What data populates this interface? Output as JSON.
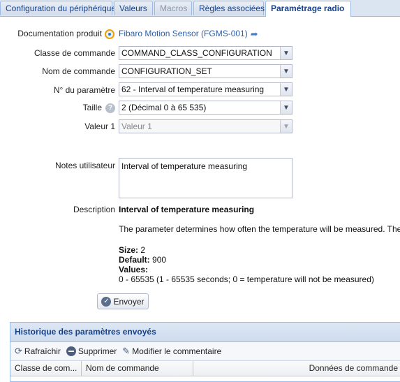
{
  "tabs": [
    {
      "label": "Configuration du périphérique",
      "state": "normal"
    },
    {
      "label": "Valeurs",
      "state": "normal"
    },
    {
      "label": "Macros",
      "state": "disabled"
    },
    {
      "label": "Règles associées",
      "state": "normal"
    },
    {
      "label": "Paramétrage radio",
      "state": "active"
    }
  ],
  "form": {
    "doc_label": "Documentation produit",
    "doc_link": "Fibaro Motion Sensor (FGMS-001)",
    "command_class_label": "Classe de commande",
    "command_class_value": "COMMAND_CLASS_CONFIGURATION",
    "command_name_label": "Nom de commande",
    "command_name_value": "CONFIGURATION_SET",
    "param_label": "N° du paramètre",
    "param_value": "62 - Interval of temperature measuring",
    "size_label": "Taille",
    "size_value": "2 (Décimal 0 à 65 535)",
    "value1_label": "Valeur 1",
    "value1_placeholder": "Valeur 1",
    "notes_label": "Notes utilisateur",
    "notes_value": "Interval of temperature measuring",
    "description_label": "Description"
  },
  "description": {
    "title": "Interval of temperature measuring",
    "text": "The parameter determines how often the temperature will be measured. The",
    "size_key": "Size:",
    "size_val": "2",
    "default_key": "Default:",
    "default_val": "900",
    "values_key": "Values:",
    "values_text": "0 - 65535 (1 - 65535 seconds; 0 = temperature will not be measured)"
  },
  "send_button": "Envoyer",
  "history": {
    "title": "Historique des paramètres envoyés",
    "refresh": "Rafraîchir",
    "delete": "Supprimer",
    "edit_comment": "Modifier le commentaire",
    "columns": [
      "Classe de com...",
      "Nom de commande",
      "Données de commande"
    ]
  },
  "colors": {
    "tab_text": "#15428b",
    "link": "#2b5da8",
    "border": "#99bbe8"
  }
}
